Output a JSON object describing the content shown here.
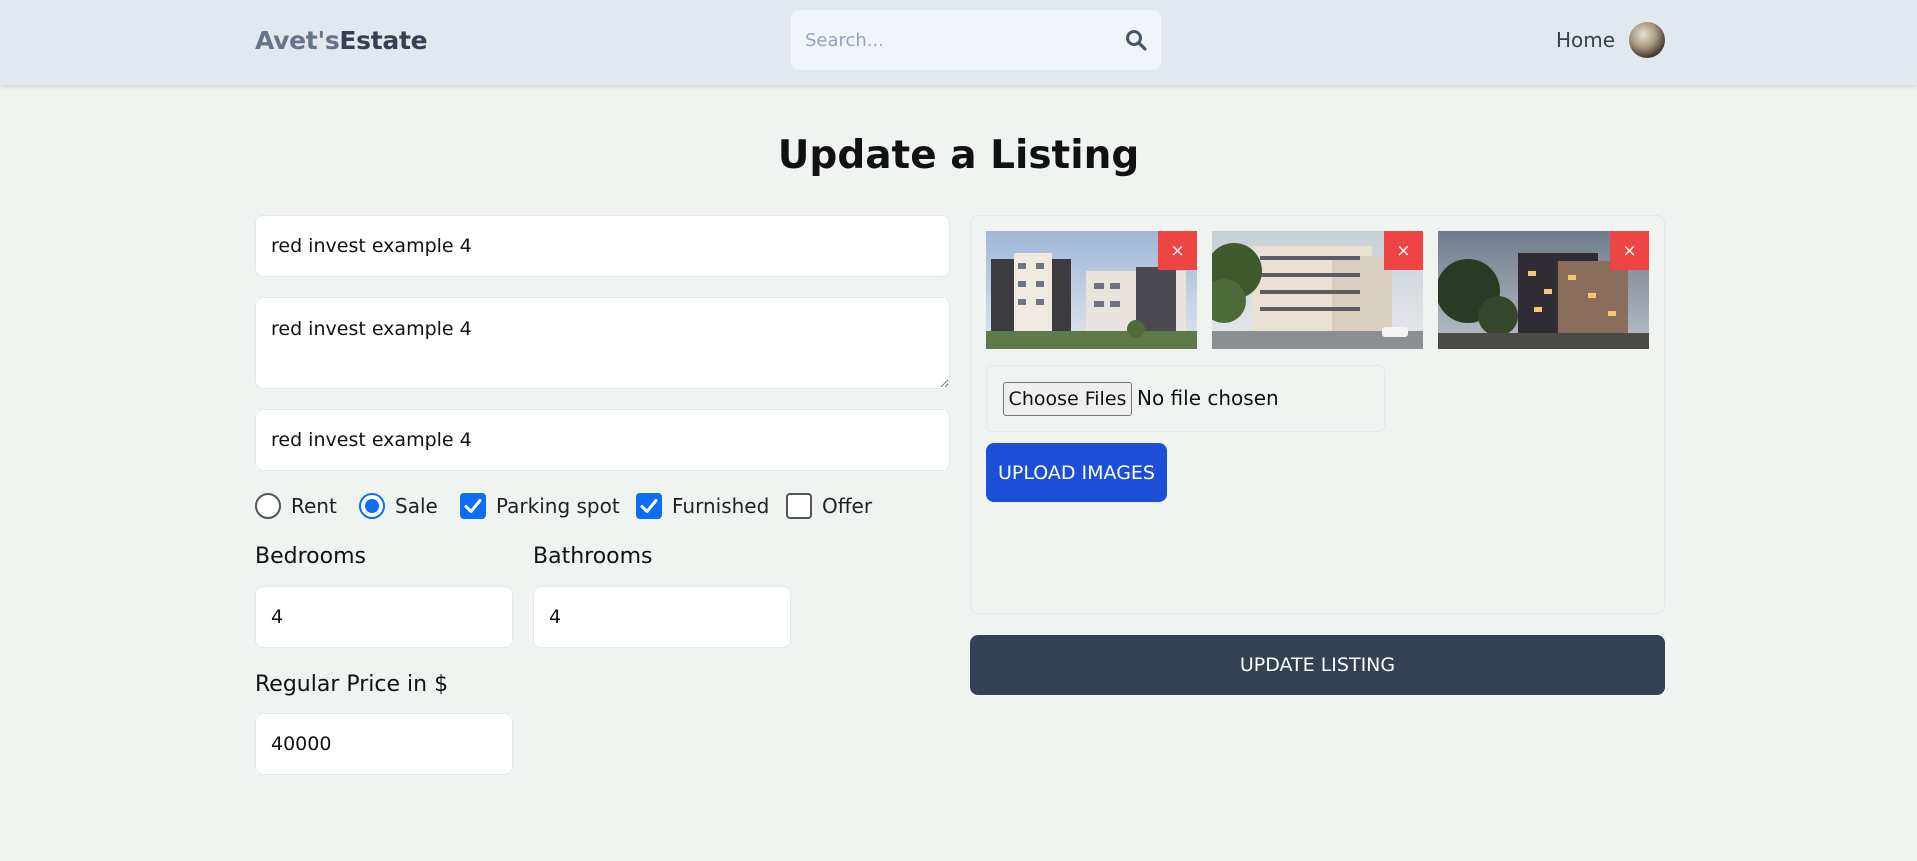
{
  "header": {
    "logo_part1": "Avet's",
    "logo_part2": "Estate",
    "search_placeholder": "Search...",
    "nav_home": "Home"
  },
  "page_title": "Update a Listing",
  "form": {
    "name": "red invest example 4",
    "description": "red invest example 4",
    "address": "red invest example 4",
    "options": [
      {
        "label": "Rent",
        "type": "radio",
        "checked": false
      },
      {
        "label": "Sale",
        "type": "radio",
        "checked": true
      },
      {
        "label": "Parking spot",
        "type": "checkbox",
        "checked": true
      },
      {
        "label": "Furnished",
        "type": "checkbox",
        "checked": true
      },
      {
        "label": "Offer",
        "type": "checkbox",
        "checked": false
      }
    ],
    "bedrooms_label": "Bedrooms",
    "bedrooms_value": "4",
    "bathrooms_label": "Bathrooms",
    "bathrooms_value": "4",
    "price_label": "Regular Price in $",
    "price_value": "40000"
  },
  "images": {
    "remove_symbol": "×",
    "choose_files_label": "Choose Files",
    "no_file_text": "No file chosen",
    "upload_label": "UPLOAD IMAGES"
  },
  "submit_label": "UPDATE LISTING",
  "colors": {
    "header_bg": "#e2e8f0",
    "page_bg": "#f0f4f0",
    "upload_button": "#1d4ed8",
    "update_button": "#334155",
    "remove_button": "#ef4444",
    "checkbox_accent": "#0b6ef5"
  }
}
